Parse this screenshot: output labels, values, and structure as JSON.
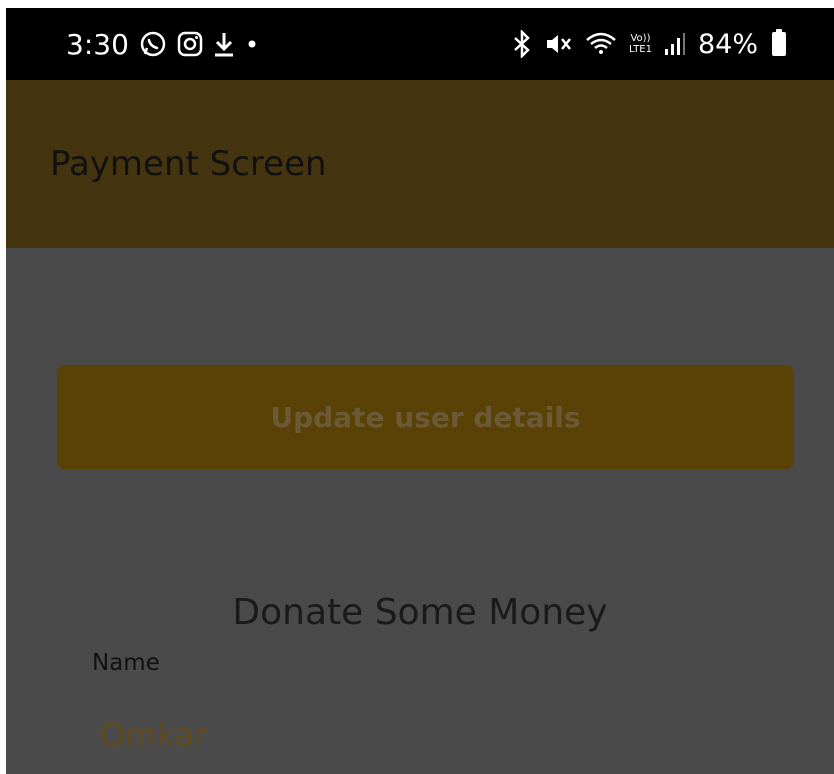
{
  "status_bar": {
    "time": "3:30",
    "battery": "84%",
    "volte_top": "Vo))",
    "volte_bottom": "LTE1",
    "icons": [
      "whatsapp-icon",
      "instagram-icon",
      "download-icon",
      "dot-icon",
      "bluetooth-icon",
      "mute-icon",
      "wifi-icon",
      "signal-icon",
      "battery-icon"
    ]
  },
  "app_bar": {
    "title": "Payment Screen",
    "color": "#453410"
  },
  "main": {
    "update_button_label": "Update user details",
    "heading": "Donate Some Money",
    "name_label": "Name",
    "name_value": "Omkar"
  },
  "colors": {
    "accent": "#5a4207",
    "overlay_bg": "#4a4a4a"
  }
}
